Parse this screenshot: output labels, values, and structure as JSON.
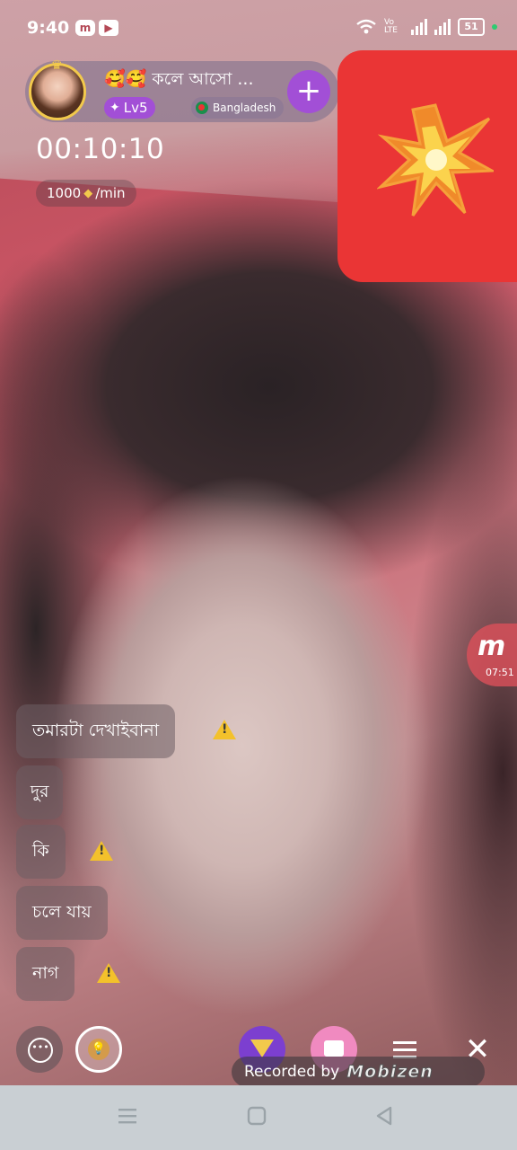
{
  "status_bar": {
    "time": "9:40",
    "app_icon_1": "m",
    "app_icon_2": "▶",
    "network_label": "Vo LTE",
    "battery": "51",
    "icons": [
      "wifi-icon",
      "signal-icon",
      "signal-icon",
      "battery-icon"
    ]
  },
  "host": {
    "name": "🥰🥰 কলে আসো ...",
    "level": "Lv5",
    "country": "Bangladesh",
    "follow_icon": "plus-icon"
  },
  "call": {
    "timer": "00:10:10",
    "rate_amount": "1000",
    "rate_unit": "/min"
  },
  "side_widget": {
    "logo": "m",
    "time": "07:51"
  },
  "chat": [
    {
      "text": "তমারটা দেখাইবানা",
      "warning": true
    },
    {
      "text": "দুর",
      "warning": false
    },
    {
      "text": "কি",
      "warning": true
    },
    {
      "text": "চলে যায়",
      "warning": false
    },
    {
      "text": "নাগ",
      "warning": true
    }
  ],
  "recorder": {
    "label": "Recorded by",
    "brand": "Mobizen"
  },
  "colors": {
    "accent_purple": "#a24fd6",
    "pip_red": "#ea3535",
    "warning_yellow": "#f3c12b"
  }
}
